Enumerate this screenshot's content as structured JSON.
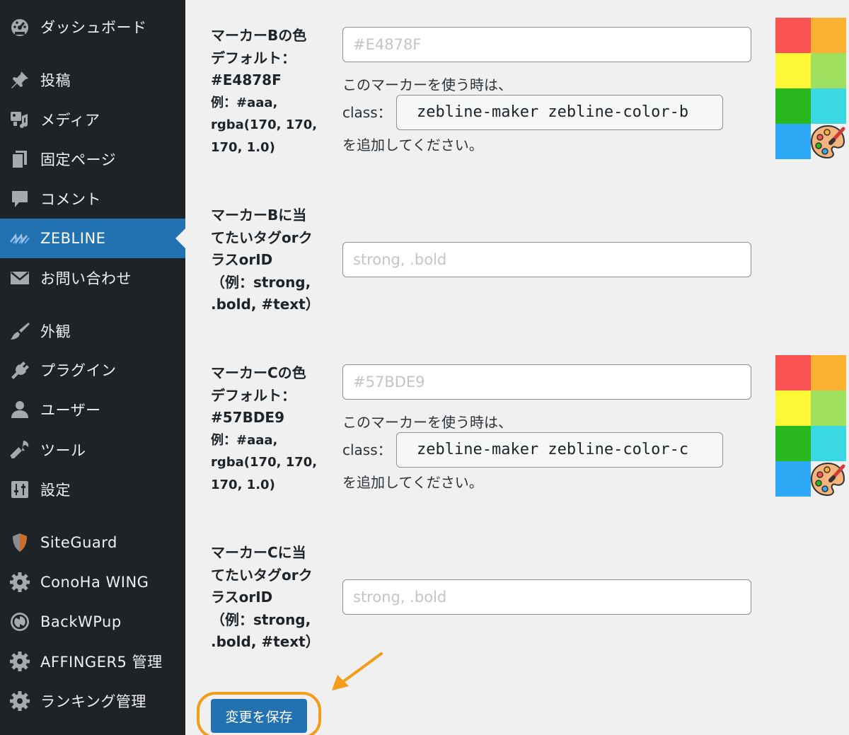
{
  "sidebar": {
    "items": [
      {
        "label": "ダッシュボード",
        "icon": "dashboard-icon",
        "active": false
      },
      {
        "label": "投稿",
        "icon": "pin-icon",
        "active": false
      },
      {
        "label": "メディア",
        "icon": "media-icon",
        "active": false
      },
      {
        "label": "固定ページ",
        "icon": "pages-icon",
        "active": false
      },
      {
        "label": "コメント",
        "icon": "comment-icon",
        "active": false
      },
      {
        "label": "ZEBLINE",
        "icon": "zebline-icon",
        "active": true
      },
      {
        "label": "お問い合わせ",
        "icon": "mail-icon",
        "active": false
      },
      {
        "label": "外観",
        "icon": "brush-icon",
        "active": false
      },
      {
        "label": "プラグイン",
        "icon": "plugin-icon",
        "active": false
      },
      {
        "label": "ユーザー",
        "icon": "user-icon",
        "active": false
      },
      {
        "label": "ツール",
        "icon": "wrench-icon",
        "active": false
      },
      {
        "label": "設定",
        "icon": "settings-sliders-icon",
        "active": false
      },
      {
        "label": "SiteGuard",
        "icon": "shield-icon",
        "active": false
      },
      {
        "label": "ConoHa WING",
        "icon": "gear-icon",
        "active": false
      },
      {
        "label": "BackWPup",
        "icon": "backup-icon",
        "active": false
      },
      {
        "label": "AFFINGER5 管理",
        "icon": "gear-icon",
        "active": false
      },
      {
        "label": "ランキング管理",
        "icon": "gear-icon",
        "active": false
      }
    ]
  },
  "marker_b_color": {
    "label_lines": [
      "マーカーBの色",
      "デフォルト：",
      "#E4878F"
    ],
    "hint_lines": [
      "例：#aaa,",
      "rgba(170, 170,",
      "170, 1.0)"
    ],
    "placeholder": "#E4878F",
    "desc_before": "このマーカーを使う時は、",
    "class_label": "class：",
    "class_value": "zebline-maker zebline-color-b",
    "desc_after": "を追加してください。"
  },
  "marker_b_target": {
    "label_lines": [
      "マーカーBに当",
      "てたいタグorク",
      "ラスorID",
      "（例：strong,",
      ".bold, #text）"
    ],
    "placeholder": "strong, .bold"
  },
  "marker_c_color": {
    "label_lines": [
      "マーカーCの色",
      "デフォルト：",
      "#57BDE9"
    ],
    "hint_lines": [
      "例：#aaa,",
      "rgba(170, 170,",
      "170, 1.0)"
    ],
    "placeholder": "#57BDE9",
    "desc_before": "このマーカーを使う時は、",
    "class_label": "class：",
    "class_value": "zebline-maker zebline-color-c",
    "desc_after": "を追加してください。"
  },
  "marker_c_target": {
    "label_lines": [
      "マーカーCに当",
      "てたいタグorク",
      "ラスorID",
      "（例：strong,",
      ".bold, #text）"
    ],
    "placeholder": "strong, .bold"
  },
  "palette_colors": [
    "#f95353",
    "#fdb133",
    "#fdf735",
    "#9fe15f",
    "#29b91e",
    "#3ad8e2",
    "#2ea9f6"
  ],
  "save_button": "変更を保存",
  "accent": "#2271b1",
  "highlight": "#f39c1a"
}
